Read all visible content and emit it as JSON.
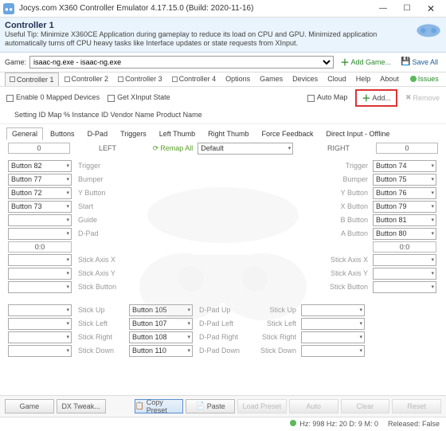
{
  "window": {
    "title": "Jocys.com X360 Controller Emulator 4.17.15.0 (Build: 2020-11-16)"
  },
  "header": {
    "title": "Controller 1",
    "tip": "Useful Tip: Minimize X360CE Application during gameplay to reduce its load on CPU and GPU. Minimized application automatically turns off CPU heavy tasks like Interface updates or state requests from XInput."
  },
  "gamebar": {
    "label": "Game:",
    "selected": "isaac-ng.exe - isaac-ng.exe",
    "add": "Add Game...",
    "save": "Save All"
  },
  "tabs": {
    "c1": "Controller 1",
    "c2": "Controller 2",
    "c3": "Controller 3",
    "c4": "Controller 4",
    "options": "Options",
    "games": "Games",
    "devices": "Devices",
    "cloud": "Cloud",
    "help": "Help",
    "about": "About",
    "issues": "Issues"
  },
  "subrow": {
    "enable": "Enable 0 Mapped Devices",
    "get": "Get XInput State",
    "automap": "Auto Map",
    "add": "Add...",
    "remove": "Remove"
  },
  "listhdr": "Setting ID Map % Instance ID Vendor Name Product Name",
  "subtabs": {
    "general": "General",
    "buttons": "Buttons",
    "dpad": "D-Pad",
    "triggers": "Triggers",
    "lthumb": "Left Thumb",
    "rthumb": "Right Thumb",
    "ff": "Force Feedback",
    "di": "Direct Input - Offline"
  },
  "toprow": {
    "left": "LEFT",
    "remap": "Remap All",
    "default": "Default",
    "right": "RIGHT",
    "zero": "0"
  },
  "labels": {
    "trigger": "Trigger",
    "bumper": "Bumper",
    "ybtn": "Y Button",
    "xbtn": "X Button",
    "start": "Start",
    "guide": "Guide",
    "dpad": "D-Pad",
    "bbtn": "B Button",
    "abtn": "A Button",
    "sax": "Stick Axis X",
    "say": "Stick Axis Y",
    "sbtn": "Stick Button",
    "su": "Stick Up",
    "sl": "Stick Left",
    "sr": "Stick Right",
    "sd": "Stick Down",
    "du": "D-Pad Up",
    "dl": "D-Pad Left",
    "dr": "D-Pad Right",
    "dd": "D-Pad Down",
    "zzero": "0:0"
  },
  "left_sel": {
    "trigger": "Button 82",
    "bumper": "Button 77",
    "ybtn": "Button 72",
    "xbtn": "Button 73"
  },
  "right_sel": {
    "trigger": "Button 74",
    "bumper": "Button 75",
    "ybtn": "Button 76",
    "xbtn": "Button 79",
    "bbtn": "Button 81",
    "abtn": "Button 80"
  },
  "center_sel": {
    "su": "Button 105",
    "sl": "Button 107",
    "sr": "Button 108",
    "sd": "Button 110"
  },
  "footer": {
    "game": "Game",
    "tweak": "DX Tweak...",
    "copy": "Copy Preset",
    "paste": "Paste",
    "load": "Load Preset",
    "auto": "Auto",
    "clear": "Clear",
    "reset": "Reset"
  },
  "status": {
    "hz": "Hz: 998 Hz: 20 D: 9 M: 0",
    "released": "Released: False"
  }
}
